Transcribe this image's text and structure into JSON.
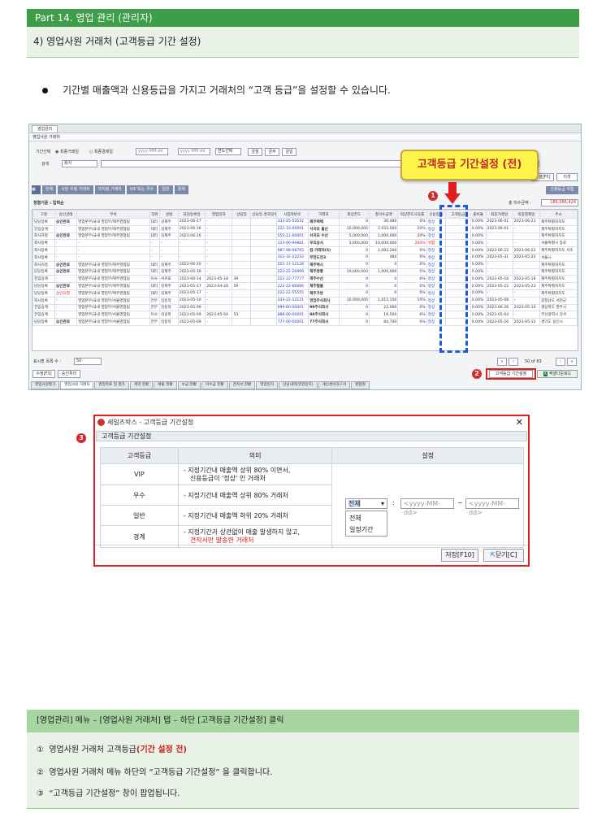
{
  "header": {
    "part": "Part 14. 영업 관리 (관리자)",
    "section": "4) 영업사원 거래처 (고객등급 기간 설정)"
  },
  "intro": "기간별 매출액과 신용등급을 가지고 거래처의 “고객 등급”을 설정할 수 있습니다.",
  "app": {
    "tab": "영업관리",
    "sub": "영업사원 거래처",
    "period_label": "기간선택",
    "opt1": "최종거래일",
    "opt2": "최종결제일",
    "date_ph": "yyyy-MM-dd",
    "year_sel": "연도선택",
    "btn_q": "금월",
    "btn_d": "금주",
    "btn_m": "금일",
    "search_label": "검색",
    "search_sel": "회사",
    "right_btn1": "엑셀[F5]",
    "right_btn2": "리셋",
    "toolbar": [
      "전체",
      "사원 지정 거래처",
      "미지정 거래처",
      "VIP 또는 우수",
      "일반",
      "경계"
    ],
    "credit_btn": "신용등급 위험",
    "sort": "정렬기준 : 입력순",
    "total_label": "총 미수금액 :",
    "total_value": "186,066,424",
    "columns": [
      "구분",
      "승인상태",
      "부서",
      "직위",
      "성명",
      "담당등록일",
      "영업일자",
      "상담일",
      "상담일 경과일수",
      "사업자번호",
      "거래처",
      "외상한도",
      "총미수금액",
      "외상한도사용률",
      "신용등급",
      "고객등급",
      "출비율",
      "최종거래일",
      "최종결제일",
      "주소"
    ],
    "rows": [
      [
        "담당등록",
        "승인완료",
        "영업본부/국내 영업부/제주영업팀",
        "대리",
        "김제주",
        "2023-06-17",
        "-",
        "",
        "",
        "333-25-53532",
        "제주택배",
        "0",
        "30,480",
        "0%",
        "정상",
        "",
        "0.00%",
        "2023-06-01",
        "2023-06-23",
        "제주특별자치도"
      ],
      [
        "전임승계",
        "-",
        "영업본부/국내 영업부/제주영업팀",
        "대리",
        "김제주",
        "2023-06-16",
        "-",
        "",
        "",
        "222-33-00001",
        "서귀포 물산",
        "10,000,000",
        "2,033,000",
        "20%",
        "정상",
        "",
        "0.00%",
        "2023-06-01",
        "-",
        "제주특별자치도"
      ],
      [
        "회사지정",
        "승인완료",
        "영업본부/국내 영업부/제주영업팀",
        "대리",
        "김제주",
        "2023-06-16",
        "-",
        "",
        "",
        "555-11-00001",
        "서귀포 수산",
        "5,000,000",
        "1,000,000",
        "20%",
        "정상",
        "",
        "0.00%",
        "-",
        "-",
        "제주특별자치도"
      ],
      [
        "회사등록",
        "-",
        "-",
        "-",
        "-",
        "-",
        "-",
        "",
        "",
        "123-00-99881",
        "우리상사",
        "5,000,000",
        "10,000,000",
        "200%",
        "위험",
        "",
        "0.00%",
        "-",
        "-",
        "서울특별시 종로"
      ],
      [
        "회사등록",
        "-",
        "-",
        "-",
        "-",
        "-",
        "-",
        "",
        "",
        "987-98-98765",
        "컴·거래처(5)",
        "0",
        "1,083,200",
        "0%",
        "정상",
        "",
        "0.00%",
        "2023-06-22",
        "2023-06-22",
        "제주특별자치도 서초"
      ],
      [
        "회사등록",
        "-",
        "-",
        "-",
        "-",
        "-",
        "-",
        "",
        "",
        "312-32-23232",
        "무한도전3",
        "0",
        "484",
        "0%",
        "정상",
        "",
        "0.00%",
        "2023-05-31",
        "2023-05-22",
        "서울시"
      ],
      [
        "회사지정",
        "승인완료",
        "영업본부/국내 영업부/제주영업팀",
        "대리",
        "김제주",
        "2023-06-20",
        "-",
        "",
        "",
        "222-11-12128",
        "제주택시",
        "0",
        "0",
        "0%",
        "정상",
        "",
        "0.00%",
        "-",
        "-",
        "제주특별자치도"
      ],
      [
        "담당등록",
        "승인완료",
        "영업본부/국내 영업부/제주영업팀",
        "대리",
        "김제주",
        "2023-05-19",
        "-",
        "",
        "",
        "222-22-29999",
        "제주쌍롱",
        "20,000,000",
        "1,000,000",
        "5%",
        "정상",
        "",
        "0.00%",
        "-",
        "-",
        "제주특별자치도"
      ],
      [
        "전임승계",
        "-",
        "영업본부/국내 영업부/제주영업팀",
        "이사",
        "서귀포",
        "2023-06-14",
        "2023-05-18",
        "39",
        "",
        "222-22-77777",
        "제주수산",
        "0",
        "0",
        "0%",
        "정상",
        "",
        "0.00%",
        "2023-05-18",
        "2023-05-18",
        "제주특별자치도"
      ],
      [
        "담당등록",
        "승인완료",
        "영업본부/국내 영업부/제주영업팀",
        "대리",
        "김제주",
        "2023-05-17",
        "2023-04-28",
        "59",
        "",
        "222-22-66666",
        "제주철물",
        "0",
        "0",
        "0%",
        "정상",
        "",
        "0.00%",
        "2023-05-22",
        "2023-05-22",
        "제주특별자치도"
      ],
      [
        "담당등록",
        "승인요청",
        "영업본부/국내 영업부/제주영업팀",
        "대리",
        "김제주",
        "2023-05-17",
        "-",
        "",
        "",
        "222-22-55555",
        "제주가방",
        "0",
        "0",
        "0%",
        "정상",
        "",
        "0.00%",
        "-",
        "-",
        "제주특별자치도"
      ],
      [
        "회사등록",
        "-",
        "영업본부/국내 영업부/서울영업팀",
        "전무",
        "김동작",
        "2023-05-10",
        "-",
        "",
        "",
        "333-22-12121",
        "영업주식회사",
        "10,000,000",
        "1,012,100",
        "10%",
        "정상",
        "",
        "0.00%",
        "2023-05-08",
        "-",
        "충청남도 서천군"
      ],
      [
        "전임승계",
        "-",
        "영업본부/국내 영업부/서울영업팀",
        "전무",
        "김동작",
        "2023-05-09",
        "-",
        "",
        "",
        "999-00-00001",
        "99주식회사",
        "0",
        "22,000",
        "0%",
        "정상",
        "",
        "0.00%",
        "2023-06-26",
        "2023-05-10",
        "경상북도 영주시"
      ],
      [
        "전임승계",
        "-",
        "영업본부/국내 영업부/서울영업팀",
        "이사",
        "김송파",
        "2023-05-09",
        "2023-05-04",
        "53",
        "",
        "888-00-00001",
        "88주식회사",
        "0",
        "16,500",
        "0%",
        "정상",
        "",
        "0.00%",
        "2023-05-04",
        "-",
        "부산광역시 강서"
      ],
      [
        "담당등록",
        "승인완료",
        "영업본부/국내 영업부/서울영업팀",
        "전무",
        "김동작",
        "2023-05-09",
        "-",
        "",
        "",
        "777-00-00001",
        "77주식회사",
        "0",
        "84,700",
        "0%",
        "정상",
        "",
        "0.00%",
        "2023-05-16",
        "2023-05-12",
        "경기도 용인시"
      ]
    ],
    "page_rows_label": "표시할 목록 수 :",
    "page_rows": "50",
    "page_info": "50 of 83",
    "fix_btn": "수정[F3]",
    "approve_btn": "승인처리",
    "grade_btn": "고객등급 기간설정",
    "excel_btn": "엑셀다운로드",
    "bottom_tabs": [
      "영업사원평가",
      "영업사원 거래처",
      "영업목표 및 평가",
      "계약 현황",
      "매출 현황",
      "수금 현황",
      "미수금 현황",
      "견적서 현황",
      "영업일지",
      "상담내역(영업일지)",
      "개인경비처구서",
      "명함철"
    ]
  },
  "callout": "고객등급 기간설정 (전)",
  "markers": [
    "1",
    "2",
    "3"
  ],
  "dialog": {
    "title": "세일즈박스 - 고객등급 기간설정",
    "section": "고객등급 기간설정",
    "col_grade": "고객등급",
    "col_meaning": "의미",
    "col_setting": "설정",
    "rows": [
      {
        "grade": "VIP",
        "m1": "- 지정기간내 매출액 상위 80% 이면서,",
        "m2": "신용등급이 '정상' 인 거래처"
      },
      {
        "grade": "우수",
        "m1": "- 지정기간내 매출액 상위 80% 거래처",
        "m2": ""
      },
      {
        "grade": "일반",
        "m1": "- 지정기간내 매출액 하위 20% 거래처",
        "m2": ""
      },
      {
        "grade": "경계",
        "m1": "- 지정기간과 상관없이 매출 발생하지 않고,",
        "m2": "견적서만 발송한 거래처"
      }
    ],
    "select_value": "전체",
    "date_ph": "<yyyy-MM-dd>",
    "tilde": "~",
    "colon": ":",
    "options": [
      "전체",
      "일정기간"
    ],
    "save": "저장[F10]",
    "close": "닫기[C]"
  },
  "guide": {
    "title": "[영업관리] 메뉴 – [영업사원 거래처] 탭 – 하단 [고객등급 기간설정] 클릭",
    "n1": "①",
    "l1a": "영업사원 거래처 고객등급",
    "l1b": "(기간 설정 전)",
    "n2": "②",
    "l2": "영업사원 거래처 메뉴 하단의 “고객등급 기간설정” 을 클릭합니다.",
    "n3": "③",
    "l3": "“고객등급 기간설정” 창이 팝업됩니다."
  },
  "colors": {
    "green": "#3d9e4a",
    "red": "#e02020",
    "callout_bg": "#fff54a",
    "dash_blue": "#1a5cd8"
  }
}
